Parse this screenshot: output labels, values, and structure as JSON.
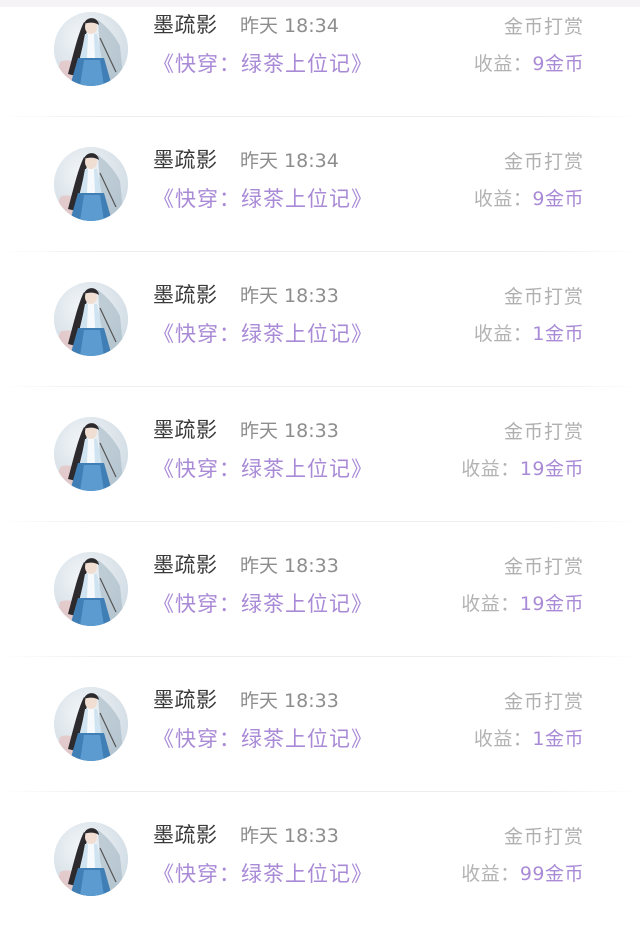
{
  "labels": {
    "income_prefix": "收益：",
    "currency": "金币",
    "tip_type": "金币打赏"
  },
  "colors": {
    "accent_purple": "#a98ad6",
    "name_text": "#3a3a3a",
    "muted_text": "#b0b0b0"
  },
  "avatar_icon": "user-avatar-illustration",
  "records": [
    {
      "name": "墨疏影",
      "time": "昨天 18:34",
      "book": "《快穿：绿茶上位记》",
      "tip_type": "金币打赏",
      "income_label": "收益：",
      "amount": "9金币"
    },
    {
      "name": "墨疏影",
      "time": "昨天 18:34",
      "book": "《快穿：绿茶上位记》",
      "tip_type": "金币打赏",
      "income_label": "收益：",
      "amount": "9金币"
    },
    {
      "name": "墨疏影",
      "time": "昨天 18:33",
      "book": "《快穿：绿茶上位记》",
      "tip_type": "金币打赏",
      "income_label": "收益：",
      "amount": "1金币"
    },
    {
      "name": "墨疏影",
      "time": "昨天 18:33",
      "book": "《快穿：绿茶上位记》",
      "tip_type": "金币打赏",
      "income_label": "收益：",
      "amount": "19金币"
    },
    {
      "name": "墨疏影",
      "time": "昨天 18:33",
      "book": "《快穿：绿茶上位记》",
      "tip_type": "金币打赏",
      "income_label": "收益：",
      "amount": "19金币"
    },
    {
      "name": "墨疏影",
      "time": "昨天 18:33",
      "book": "《快穿：绿茶上位记》",
      "tip_type": "金币打赏",
      "income_label": "收益：",
      "amount": "1金币"
    },
    {
      "name": "墨疏影",
      "time": "昨天 18:33",
      "book": "《快穿：绿茶上位记》",
      "tip_type": "金币打赏",
      "income_label": "收益：",
      "amount": "99金币"
    }
  ]
}
